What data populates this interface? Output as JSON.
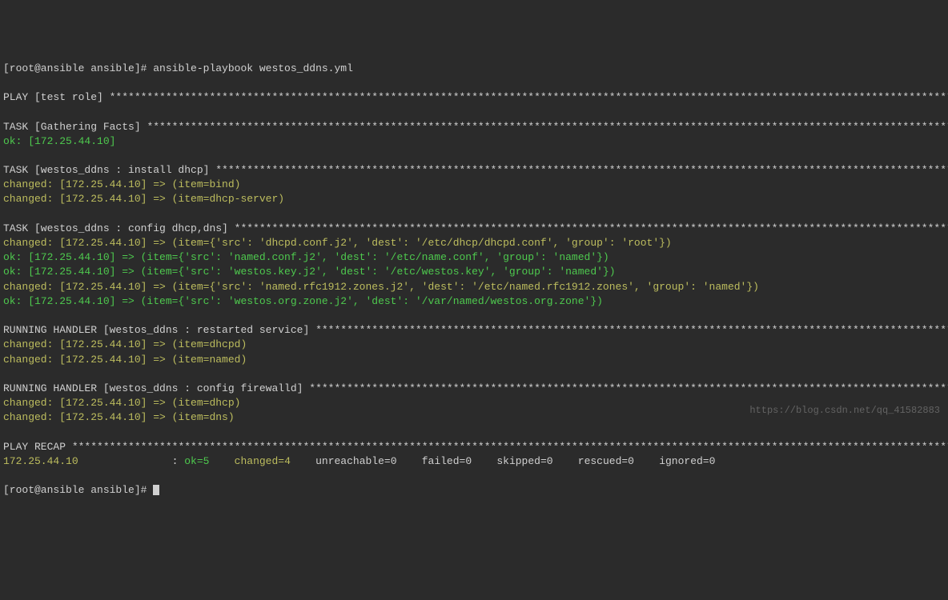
{
  "prompt1": "[root@ansible ansible]# ",
  "command": "ansible-playbook westos_ddns.yml",
  "play_header": "PLAY [test role] ",
  "play_stars": "*******************************************************************************************************************************************",
  "task1_header": "TASK [Gathering Facts] ",
  "task1_stars": "*************************************************************************************************************************************",
  "task1_line1": "ok: [172.25.44.10]",
  "task2_header": "TASK [westos_ddns : install dhcp] ",
  "task2_stars": "**************************************************************************************************************************",
  "task2_line1": "changed: [172.25.44.10] => (item=bind)",
  "task2_line2": "changed: [172.25.44.10] => (item=dhcp-server)",
  "task3_header": "TASK [westos_ddns : config dhcp,dns] ",
  "task3_stars": "***********************************************************************************************************************",
  "task3_line1": "changed: [172.25.44.10] => (item={'src': 'dhcpd.conf.j2', 'dest': '/etc/dhcp/dhcpd.conf', 'group': 'root'})",
  "task3_line2": "ok: [172.25.44.10] => (item={'src': 'named.conf.j2', 'dest': '/etc/name.conf', 'group': 'named'})",
  "task3_line3": "ok: [172.25.44.10] => (item={'src': 'westos.key.j2', 'dest': '/etc/westos.key', 'group': 'named'})",
  "task3_line4": "changed: [172.25.44.10] => (item={'src': 'named.rfc1912.zones.j2', 'dest': '/etc/named.rfc1912.zones', 'group': 'named'})",
  "task3_line5": "ok: [172.25.44.10] => (item={'src': 'westos.org.zone.j2', 'dest': '/var/named/westos.org.zone'})",
  "handler1_header": "RUNNING HANDLER [westos_ddns : restarted service] ",
  "handler1_stars": "**********************************************************************************************************",
  "handler1_line1": "changed: [172.25.44.10] => (item=dhcpd)",
  "handler1_line2": "changed: [172.25.44.10] => (item=named)",
  "handler2_header": "RUNNING HANDLER [westos_ddns : config firewalld] ",
  "handler2_stars": "***********************************************************************************************************",
  "handler2_line1": "changed: [172.25.44.10] => (item=dhcp)",
  "handler2_line2": "changed: [172.25.44.10] => (item=dns)",
  "recap_header": "PLAY RECAP ",
  "recap_stars": "*************************************************************************************************************************************************",
  "recap_host": "172.25.44.10               ",
  "recap_colon": ": ",
  "recap_ok": "ok=5    ",
  "recap_changed": "changed=4    ",
  "recap_unreachable": "unreachable=0    ",
  "recap_failed": "failed=0    ",
  "recap_skipped": "skipped=0    ",
  "recap_rescued": "rescued=0    ",
  "recap_ignored": "ignored=0",
  "prompt2": "[root@ansible ansible]# ",
  "watermark": "https://blog.csdn.net/qq_41582883"
}
